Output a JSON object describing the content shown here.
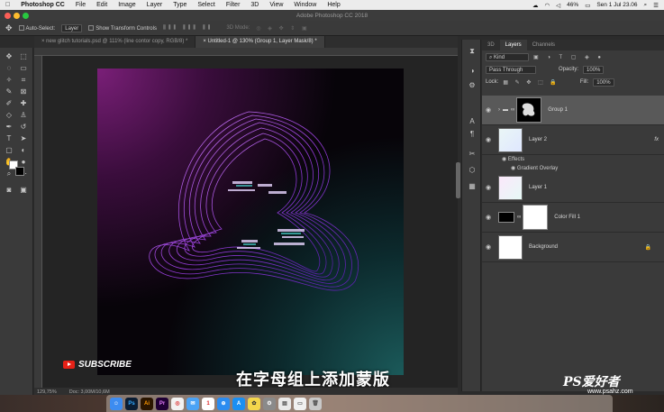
{
  "menubar": {
    "app": "Photoshop CC",
    "items": [
      "File",
      "Edit",
      "Image",
      "Layer",
      "Type",
      "Select",
      "Filter",
      "3D",
      "View",
      "Window",
      "Help"
    ],
    "battery": "46%",
    "datetime": "Sen 1 Jul  23.06"
  },
  "window": {
    "title": "Adobe Photoshop CC 2018"
  },
  "options": {
    "auto_select_label": "Auto-Select:",
    "auto_select_value": "Layer",
    "transform_label": "Show Transform Controls",
    "mode_3d": "3D Mode:"
  },
  "tabs": [
    {
      "label": "new glitch tutorials.psd @ 111% (line contor copy, RGB/8) *"
    },
    {
      "label": "Untitled-1 @ 130% (Group 1, Layer Mask/8) *"
    }
  ],
  "status": {
    "zoom": "129,75%",
    "doc": "Doc: 3,00M/10,6M"
  },
  "overlay": {
    "subscribe": "SUBSCRIBE",
    "caption": "在字母组上添加蒙版"
  },
  "panels": {
    "tabs": [
      "3D",
      "Layers",
      "Channels"
    ],
    "filter_kind": "Kind",
    "blend_mode": "Pass Through",
    "opacity_label": "Opacity:",
    "opacity": "100%",
    "lock_label": "Lock:",
    "fill_label": "Fill:",
    "fill": "100%",
    "fx": "fx",
    "effects_label": "Effects",
    "effect_item": "Gradient Overlay"
  },
  "layers": [
    {
      "name": "Group 1",
      "selected": true
    },
    {
      "name": "Layer 2"
    },
    {
      "name": "Layer 1"
    },
    {
      "name": "Color Fill 1"
    },
    {
      "name": "Background"
    }
  ],
  "watermark": {
    "brand": "PS爱好者",
    "url": "www.psahz.com"
  },
  "dock_apps": [
    "Finder",
    "Ps",
    "Ai",
    "Pr",
    "Chrome",
    "Mail",
    "Calendar",
    "Safari",
    "App Store",
    "Photos",
    "Settings",
    "Files",
    "Music",
    "Trash"
  ],
  "colors": {
    "accent": "#4b8cf7",
    "youtube_red": "#e62117",
    "canvas_purple": "#7a1f78",
    "canvas_teal": "#1b5a5a"
  }
}
